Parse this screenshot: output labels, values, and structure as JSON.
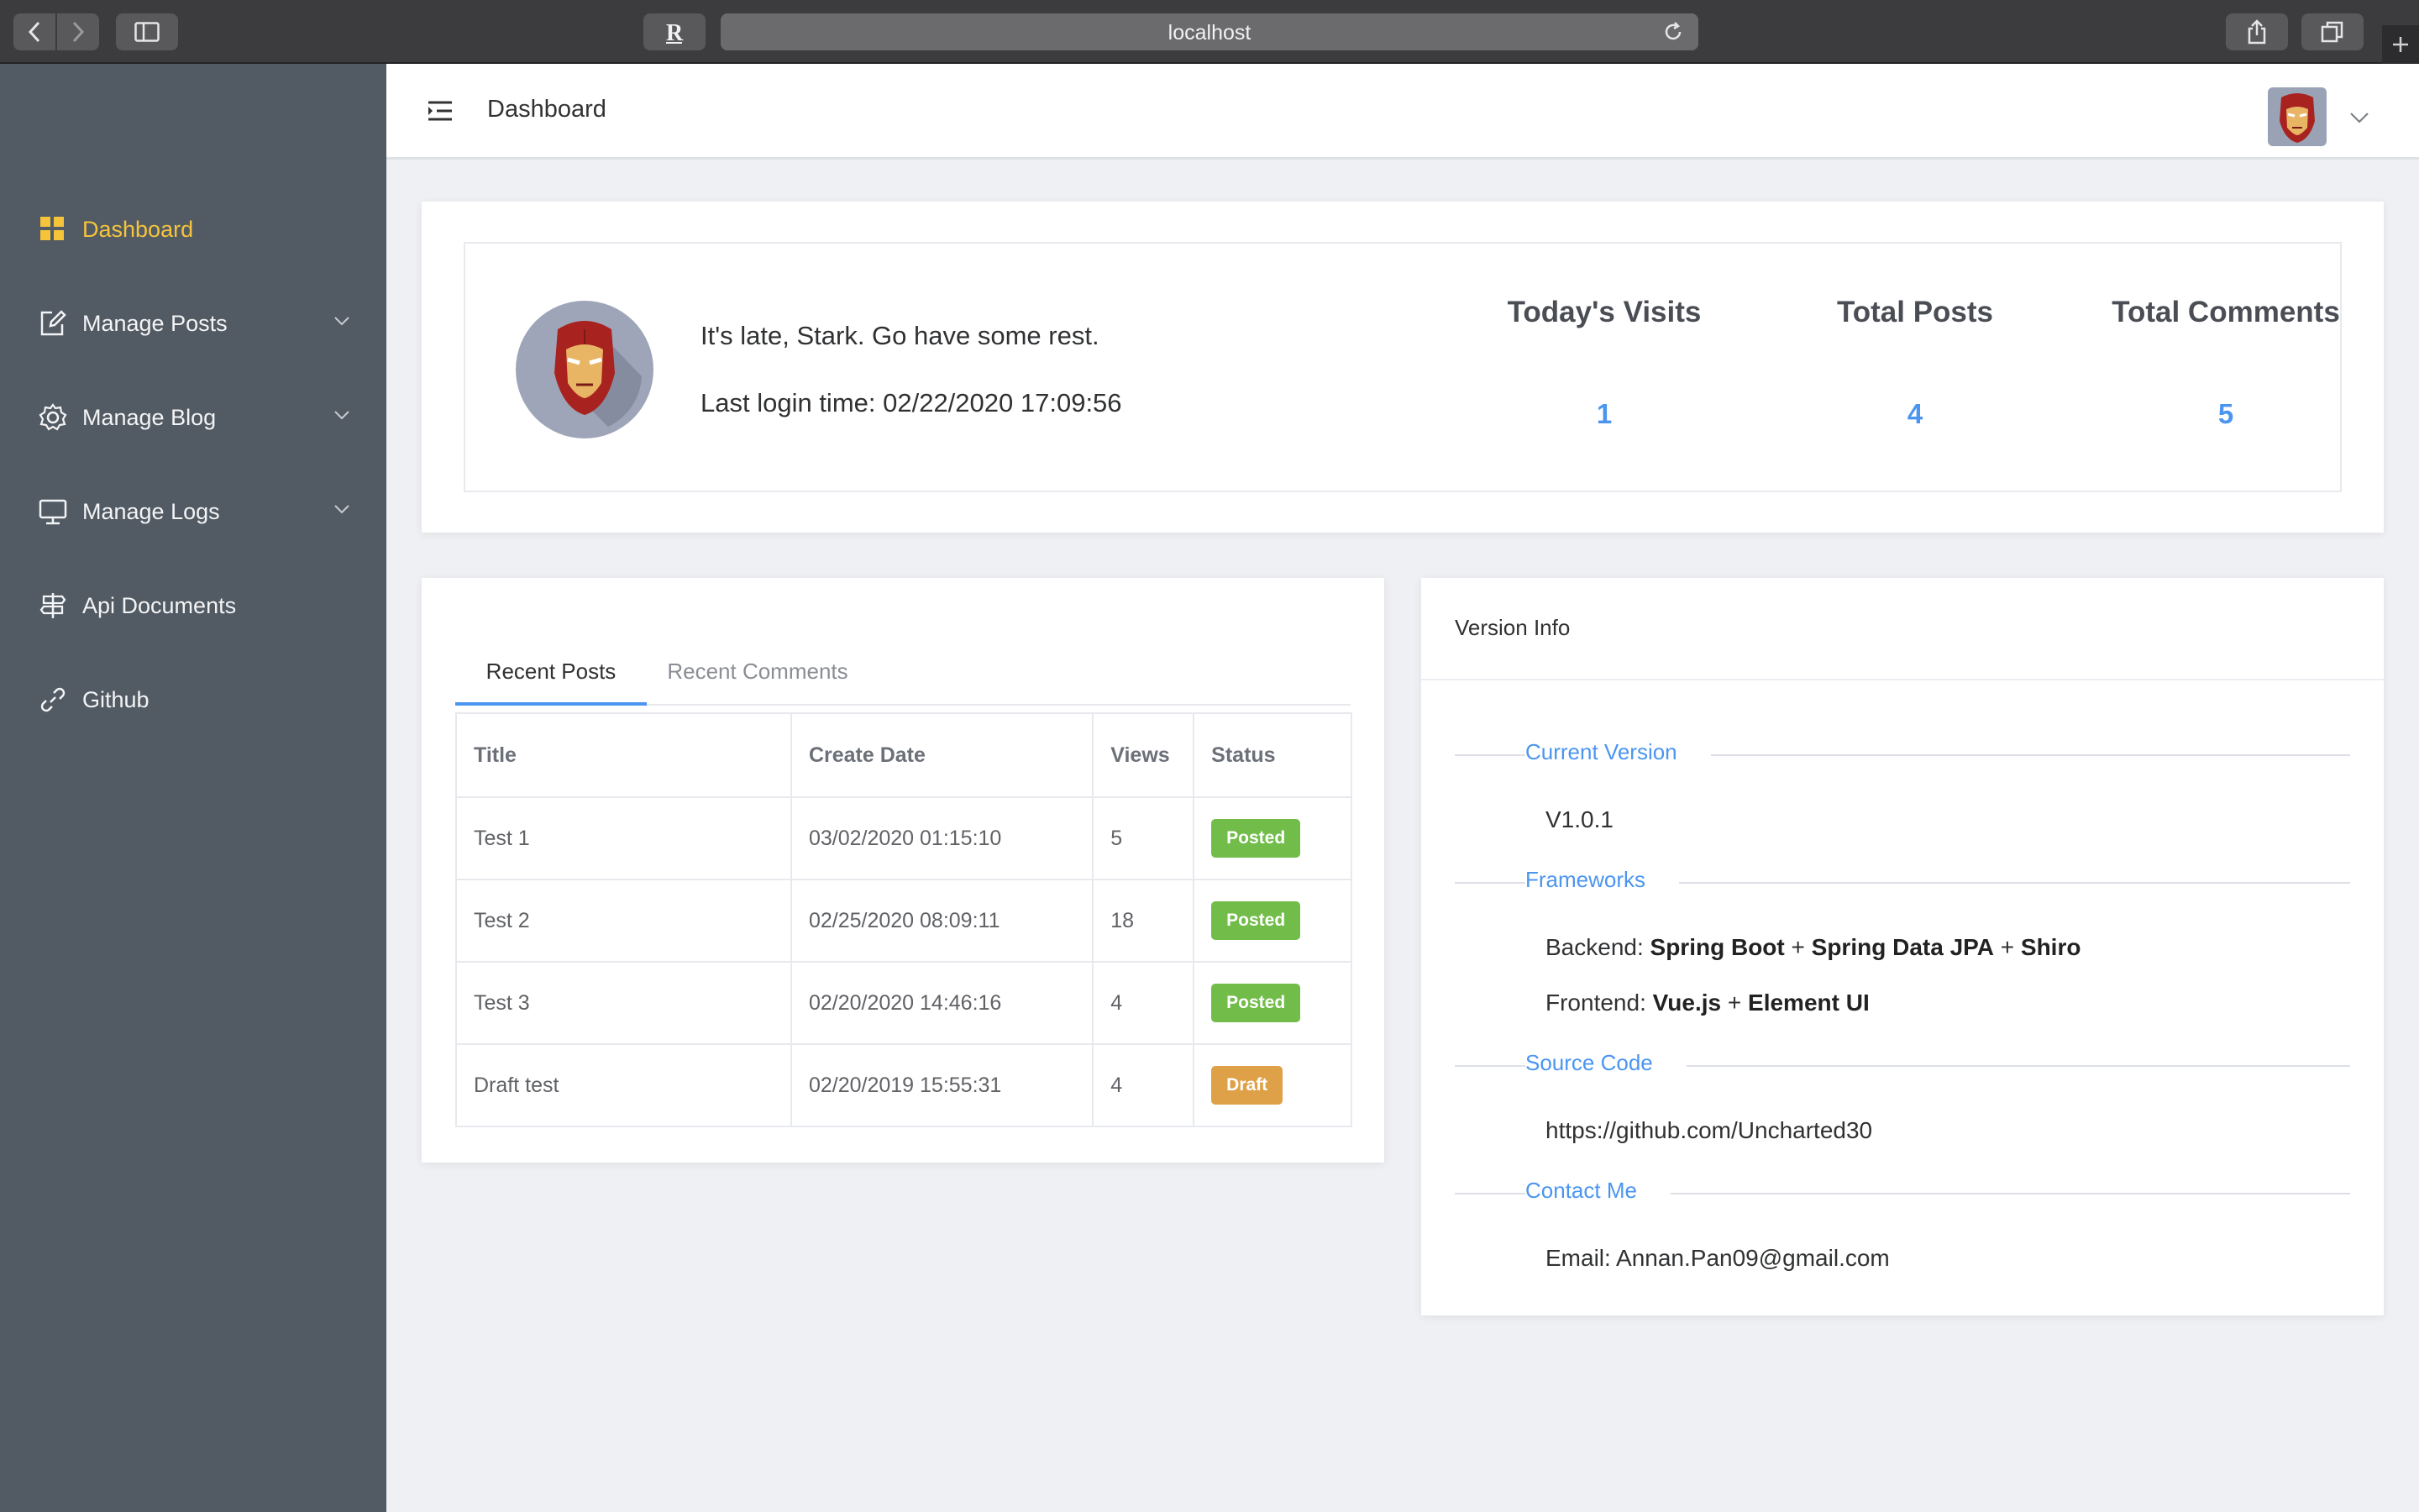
{
  "browser": {
    "address": "localhost"
  },
  "sidebar": {
    "items": [
      {
        "label": "Dashboard"
      },
      {
        "label": "Manage Posts"
      },
      {
        "label": "Manage Blog"
      },
      {
        "label": "Manage Logs"
      },
      {
        "label": "Api Documents"
      },
      {
        "label": "Github"
      }
    ]
  },
  "header": {
    "breadcrumb": "Dashboard"
  },
  "welcome": {
    "greeting": "It's late, Stark. Go have some rest.",
    "last_login": "Last login time: 02/22/2020 17:09:56",
    "stats": [
      {
        "label": "Today's Visits",
        "value": "1"
      },
      {
        "label": "Total Posts",
        "value": "4"
      },
      {
        "label": "Total Comments",
        "value": "5"
      }
    ]
  },
  "posts": {
    "tabs": [
      "Recent Posts",
      "Recent Comments"
    ],
    "columns": [
      "Title",
      "Create Date",
      "Views",
      "Status"
    ],
    "rows": [
      {
        "title": "Test 1",
        "date": "03/02/2020 01:15:10",
        "views": "5",
        "status": "Posted"
      },
      {
        "title": "Test 2",
        "date": "02/25/2020 08:09:11",
        "views": "18",
        "status": "Posted"
      },
      {
        "title": "Test 3",
        "date": "02/20/2020 14:46:16",
        "views": "4",
        "status": "Posted"
      },
      {
        "title": "Draft test",
        "date": "02/20/2019 15:55:31",
        "views": "4",
        "status": "Draft"
      }
    ]
  },
  "version": {
    "title": "Version Info",
    "current_label": "Current Version",
    "current_value": "V1.0.1",
    "frameworks_label": "Frameworks",
    "backend_prefix": "Backend:",
    "backend_a": "Spring Boot",
    "backend_b": "Spring Data JPA",
    "backend_c": "Shiro",
    "frontend_prefix": "Frontend:",
    "frontend_a": "Vue.js",
    "frontend_b": "Element UI",
    "plus": "+",
    "source_label": "Source Code",
    "source_value": "https://github.com/Uncharted30",
    "contact_label": "Contact Me",
    "contact_value": "Email: Annan.Pan09@gmail.com"
  },
  "colors": {
    "sidebar_bg": "#525a64",
    "active": "#f5c43b",
    "accent": "#4b95f0",
    "posted": "#72bd4a",
    "draft": "#dea147"
  }
}
